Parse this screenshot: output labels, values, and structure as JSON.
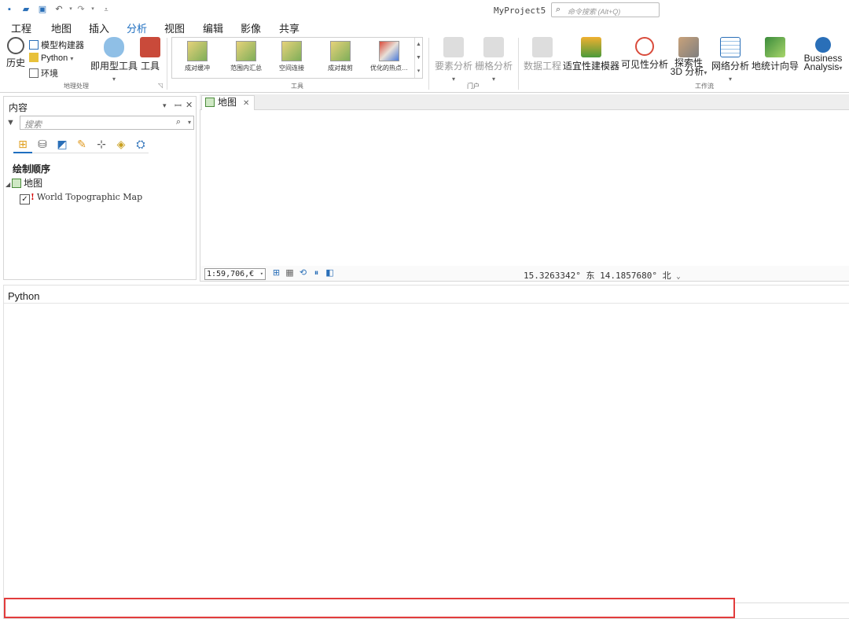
{
  "titlebar": {
    "project_title": "MyProject5",
    "search_placeholder": "命令搜索 (Alt+Q)"
  },
  "menu": {
    "tabs": [
      "工程",
      "地图",
      "插入",
      "分析",
      "视图",
      "编辑",
      "影像",
      "共享"
    ],
    "active": "分析"
  },
  "ribbon": {
    "geoprocessing": {
      "label": "地理处理",
      "history": "历史",
      "model_builder": "模型构建器",
      "python": "Python",
      "environments": "环境",
      "ready_tools": "即用型工具",
      "tools": "工具"
    },
    "tools_group": {
      "label": "工具",
      "gallery": [
        "成对缓冲",
        "范围内汇总",
        "空间连接",
        "成对裁剪",
        "优化的热点…"
      ]
    },
    "portal": {
      "label": "门户",
      "feature_analysis": "要素分析",
      "raster_analysis": "栅格分析"
    },
    "workflows": {
      "label": "工作流",
      "data_engineering": "数据工程",
      "suitability_modeler": "适宜性建模器",
      "visibility_analysis": "可见性分析",
      "exploratory_3d_line1": "探索性",
      "exploratory_3d_line2": "3D 分析",
      "network_analysis": "网络分析",
      "geostatistical_wizard": "地统计向导",
      "business_line1": "Business",
      "business_line2": "Analysis"
    }
  },
  "contents": {
    "title": "内容",
    "search_placeholder": "搜索",
    "drawing_order": "绘制顺序",
    "map_name": "地图",
    "layer_name": "World Topographic Map",
    "layer_checked": true
  },
  "map_view": {
    "tab_label": "地图",
    "scale": "1:59,706,€",
    "coordinates": "15.3263342° 东 14.1857680° 北"
  },
  "python": {
    "title": "Python",
    "input_value": ""
  },
  "colors": {
    "accent": "#1f6fc0",
    "highlight_box": "#e23c3c"
  }
}
